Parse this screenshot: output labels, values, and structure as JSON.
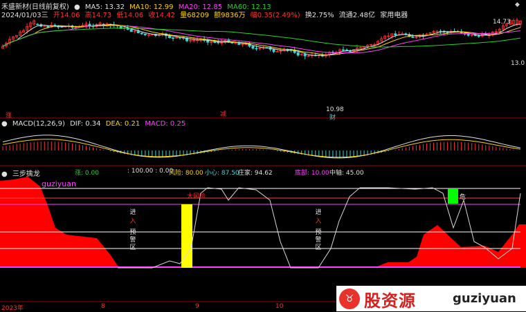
{
  "header": {
    "stock_name": "禾盛新材(日线前复权)",
    "ma5": "MA5: 13.32",
    "ma10": "MA10: 12.99",
    "ma20": "MA20: 12.85",
    "ma60": "MA60: 12.13",
    "date": "2024/01/03三",
    "open": "开14.06",
    "high": "高14.73",
    "low": "低14.06",
    "close": "收14.42",
    "volume": "量68209",
    "amount": "额9836万",
    "change": "幅0.35(2.49%)",
    "turnover": "换2.75%",
    "float_cap": "流通2.48亿",
    "industry": "家用电器"
  },
  "price_panel": {
    "label_high": "14.73",
    "label_low": "10.98",
    "label_right": "13.0",
    "label_zhang": "涨",
    "label_jian": "减",
    "label_cai": "财"
  },
  "macd": {
    "title": "MACD(12,26,9)",
    "dif": "DIF: 0.34",
    "dea": "DEA: 0.21",
    "macd": "MACD: 0.25"
  },
  "indicator": {
    "title": "三步擒龙",
    "zhang": "涨: 0.00",
    "vals": ": 100.00 : 0.00",
    "risk": "风险: 80.00",
    "caution": "小心: 87.50",
    "dealer": "庄家: 94.62",
    "bottom": "底部: 10.00",
    "axis": "中轴: 45.00",
    "watermark": "guziyuan",
    "big_risk": "大风险",
    "enter_1": "进",
    "enter_2": "入",
    "warn": "预警区",
    "wei": "危"
  },
  "xaxis": {
    "year": "2023年",
    "m8": "8",
    "m9": "9",
    "m10": "10"
  },
  "badge": {
    "cn": "股资源",
    "en": "guziyuan"
  },
  "colors": {
    "up": "#ff3030",
    "down": "#3fd6d6",
    "ma5": "#e0e0e0",
    "ma10": "#ffd400",
    "ma20": "#ff40ff",
    "ma60": "#25d425",
    "panel_line": "#a00000"
  }
}
